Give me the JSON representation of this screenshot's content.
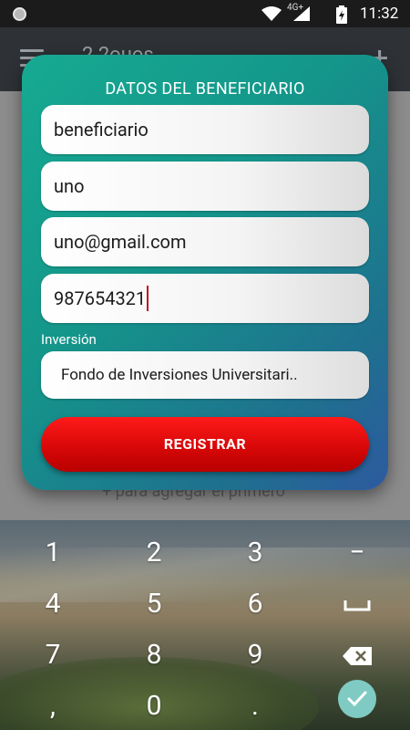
{
  "status_bar": {
    "time": "11:32",
    "network": "4G+"
  },
  "app_bar": {
    "title": "2 2ouos"
  },
  "background": {
    "empty_hint": "+  para agregar el primero"
  },
  "dialog": {
    "title": "DATOS DEL BENEFICIARIO",
    "fields": [
      {
        "name": "nombre",
        "value": "beneficiario"
      },
      {
        "name": "apellido",
        "value": "uno"
      },
      {
        "name": "email",
        "value": "uno@gmail.com"
      },
      {
        "name": "telefono",
        "value": "987654321"
      }
    ],
    "investment_label": "Inversión",
    "investment_selected": "Fondo de Inversiones Universitari..",
    "register_label": "REGISTRAR"
  },
  "keyboard": {
    "rows": [
      [
        "1",
        "2",
        "3"
      ],
      [
        "4",
        "5",
        "6"
      ],
      [
        "7",
        "8",
        "9"
      ],
      [
        ",",
        "0",
        "."
      ]
    ],
    "minus": "−"
  },
  "colors": {
    "dialog_gradient_start": "#16aa92",
    "dialog_gradient_end": "#2d5aa0",
    "register_button": "#e00808",
    "cursor": "#c0101a",
    "done_key": "#7fcbc3"
  }
}
